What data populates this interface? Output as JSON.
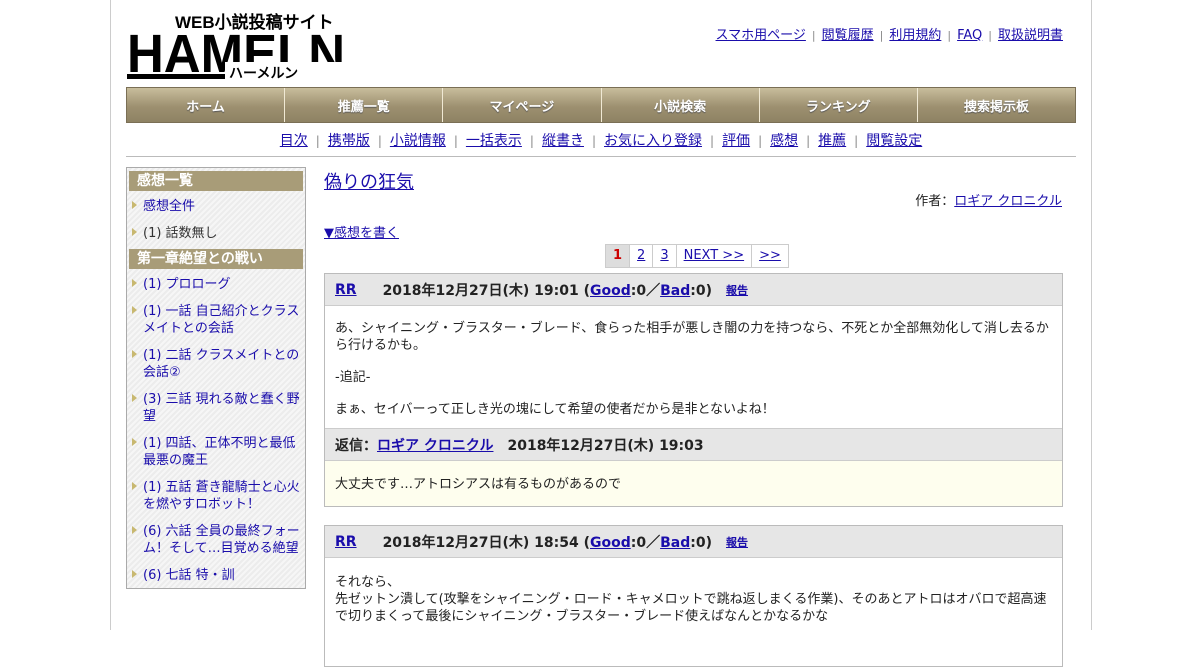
{
  "logo": {
    "text_web": "WEB小説投稿サイト",
    "text_main": "HAMELN",
    "text_kana": "ハーメルン"
  },
  "top_links": [
    "スマホ用ページ",
    "閲覧履歴",
    "利用規約",
    "FAQ",
    "取扱説明書"
  ],
  "main_nav": [
    "ホーム",
    "推薦一覧",
    "マイページ",
    "小説検索",
    "ランキング",
    "捜索掲示板"
  ],
  "sub_nav": [
    "目次",
    "携帯版",
    "小説情報",
    "一括表示",
    "縦書き",
    "お気に入り登録",
    "評価",
    "感想",
    "推薦",
    "閲覧設定"
  ],
  "sidebar": {
    "sections": [
      {
        "title": "感想一覧",
        "items": [
          {
            "label": "感想全件",
            "link": true
          },
          {
            "label": "(1) 話数無し",
            "link": false
          }
        ]
      },
      {
        "title": "第一章絶望との戦い",
        "items": [
          {
            "label": "(1) プロローグ",
            "link": true
          },
          {
            "label": "(1) 一話 自己紹介とクラスメイトとの会話",
            "link": true
          },
          {
            "label": "(1) 二話 クラスメイトとの会話②",
            "link": true
          },
          {
            "label": "(3) 三話 現れる敵と蠢く野望",
            "link": true
          },
          {
            "label": "(1) 四話、正体不明と最低最悪の魔王",
            "link": true
          },
          {
            "label": "(1) 五話 蒼き龍騎士と心火を燃やすロボット！",
            "link": true
          },
          {
            "label": "(6) 六話 全員の最終フォーム！そして…目覚める絶望",
            "link": true
          },
          {
            "label": "(6) 七話 特・訓",
            "link": true
          }
        ]
      }
    ]
  },
  "novel": {
    "title": "偽りの狂気",
    "author_label": "作者：",
    "author": "ロギア クロニクル",
    "write_link": "▼感想を書く"
  },
  "pager": [
    "1",
    "2",
    "3",
    "NEXT >>",
    ">>"
  ],
  "reviews": [
    {
      "user": "RR",
      "date": "2018年12月27日(木) 19:01 (",
      "good_label": "Good",
      "good_count": ":0／",
      "bad_label": "Bad",
      "bad_count": ":0)",
      "report": "報告",
      "body": [
        "あ、シャイニング・ブラスター・ブレード、食らった相手が悪しき闇の力を持つなら、不死とか全部無効化して消し去るから行けるかも。",
        "-追記-",
        "まぁ、セイバーって正しき光の塊にして希望の使者だから是非とないよね！"
      ],
      "reply": {
        "label": "返信：",
        "author": "ロギア クロニクル",
        "date": "2018年12月27日(木) 19:03",
        "body": "大丈夫です…アトロシアスは有るものがあるので"
      }
    },
    {
      "user": "RR",
      "date": "2018年12月27日(木) 18:54 (",
      "good_label": "Good",
      "good_count": ":0／",
      "bad_label": "Bad",
      "bad_count": ":0)",
      "report": "報告",
      "body": [
        "それなら、",
        "先ゼットン潰して(攻撃をシャイニング・ロード・キャメロットで跳ね返しまくる作業)、そのあとアトロはオバロで超高速で切りまくって最後にシャイニング・ブラスター・ブレード使えばなんとかなるかな"
      ]
    }
  ]
}
